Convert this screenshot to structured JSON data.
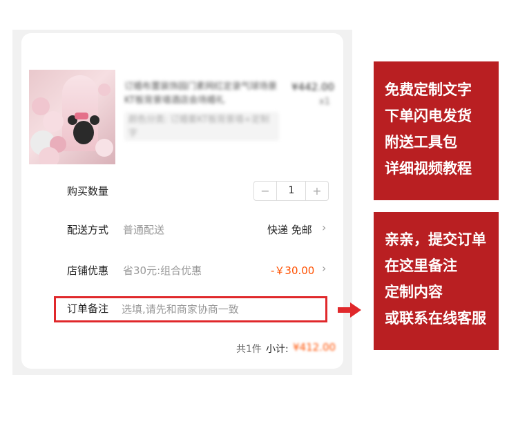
{
  "product": {
    "title": "订婚布置装饰园门素网红定录气球场景KT板背景墙酒店会场婚礼",
    "spec": "颜色分类: 订婚套KT板背景墙+定制字",
    "price": "¥442.00",
    "quantity_badge": "x1"
  },
  "quantity": {
    "label": "购买数量",
    "minus": "−",
    "value": "1",
    "plus": "+"
  },
  "delivery": {
    "label": "配送方式",
    "hint": "普通配送",
    "value": "快递 免邮"
  },
  "discount": {
    "label": "店铺优惠",
    "hint": "省30元:组合优惠",
    "value": "-￥30.00"
  },
  "memo": {
    "label": "订单备注",
    "placeholder": "选填,请先和商家协商一致"
  },
  "summary": {
    "count": "共1件",
    "subtotal_label": "小计:",
    "subtotal_value": "¥412.00"
  },
  "promo_top": [
    "免费定制文字",
    "下单闪电发货",
    "附送工具包",
    "详细视频教程"
  ],
  "promo_bottom": [
    "亲亲，提交订单",
    "在这里备注",
    "定制内容",
    "或联系在线客服"
  ],
  "colors": {
    "accent": "#ff5000",
    "highlight_red": "#e0282b",
    "banner_red": "#b91f22"
  },
  "icons": {
    "chevron": "chevron-right-icon",
    "arrow": "arrow-right-icon"
  }
}
